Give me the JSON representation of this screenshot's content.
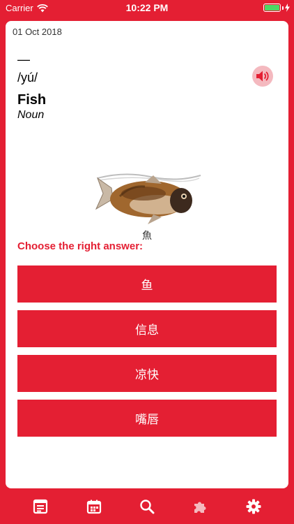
{
  "status_bar": {
    "carrier": "Carrier",
    "time": "10:22 PM",
    "battery_color": "#4cd964"
  },
  "card": {
    "date": "01 Oct 2018",
    "dash": "—",
    "pinyin": "/yú/",
    "word": "Fish",
    "part_of_speech": "Noun",
    "illustration_icon": "fish-image",
    "character_caption": "魚",
    "speaker_icon": "speaker-icon"
  },
  "quiz": {
    "prompt": "Choose the right answer:",
    "answers": [
      "鱼",
      "信息",
      "凉快",
      "嘴唇"
    ]
  },
  "tab_bar": {
    "items": [
      {
        "icon": "flashcard-icon"
      },
      {
        "icon": "calendar-icon"
      },
      {
        "icon": "search-icon"
      },
      {
        "icon": "puzzle-icon"
      },
      {
        "icon": "gear-icon"
      }
    ]
  },
  "colors": {
    "accent": "#e41f33",
    "accent_light": "#f4b9bf",
    "card_bg": "#ffffff"
  }
}
